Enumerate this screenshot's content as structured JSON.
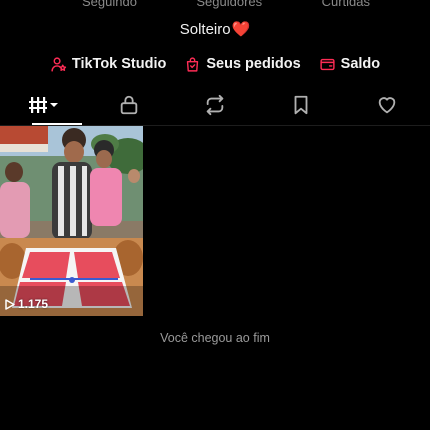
{
  "stats": {
    "following_label": "Seguindo",
    "followers_label": "Seguidores",
    "likes_label": "Curtidas"
  },
  "bio": {
    "text": "Solteiro",
    "emoji": "❤️"
  },
  "quick_links": [
    {
      "label": "TikTok Studio",
      "icon": "person-star-icon"
    },
    {
      "label": "Seus pedidos",
      "icon": "shopping-bag-icon"
    },
    {
      "label": "Saldo",
      "icon": "wallet-icon"
    }
  ],
  "tabs": [
    {
      "icon": "grid-icon",
      "active": true
    },
    {
      "icon": "lock-icon",
      "active": false
    },
    {
      "icon": "repost-icon",
      "active": false
    },
    {
      "icon": "bookmark-icon",
      "active": false
    },
    {
      "icon": "heart-icon",
      "active": false
    }
  ],
  "videos": [
    {
      "views": "1.175"
    }
  ],
  "end_message": "Você chegou ao fim",
  "colors": {
    "background": "#000000",
    "accent": "#fe2c55",
    "muted_text": "#8a8a8a"
  }
}
